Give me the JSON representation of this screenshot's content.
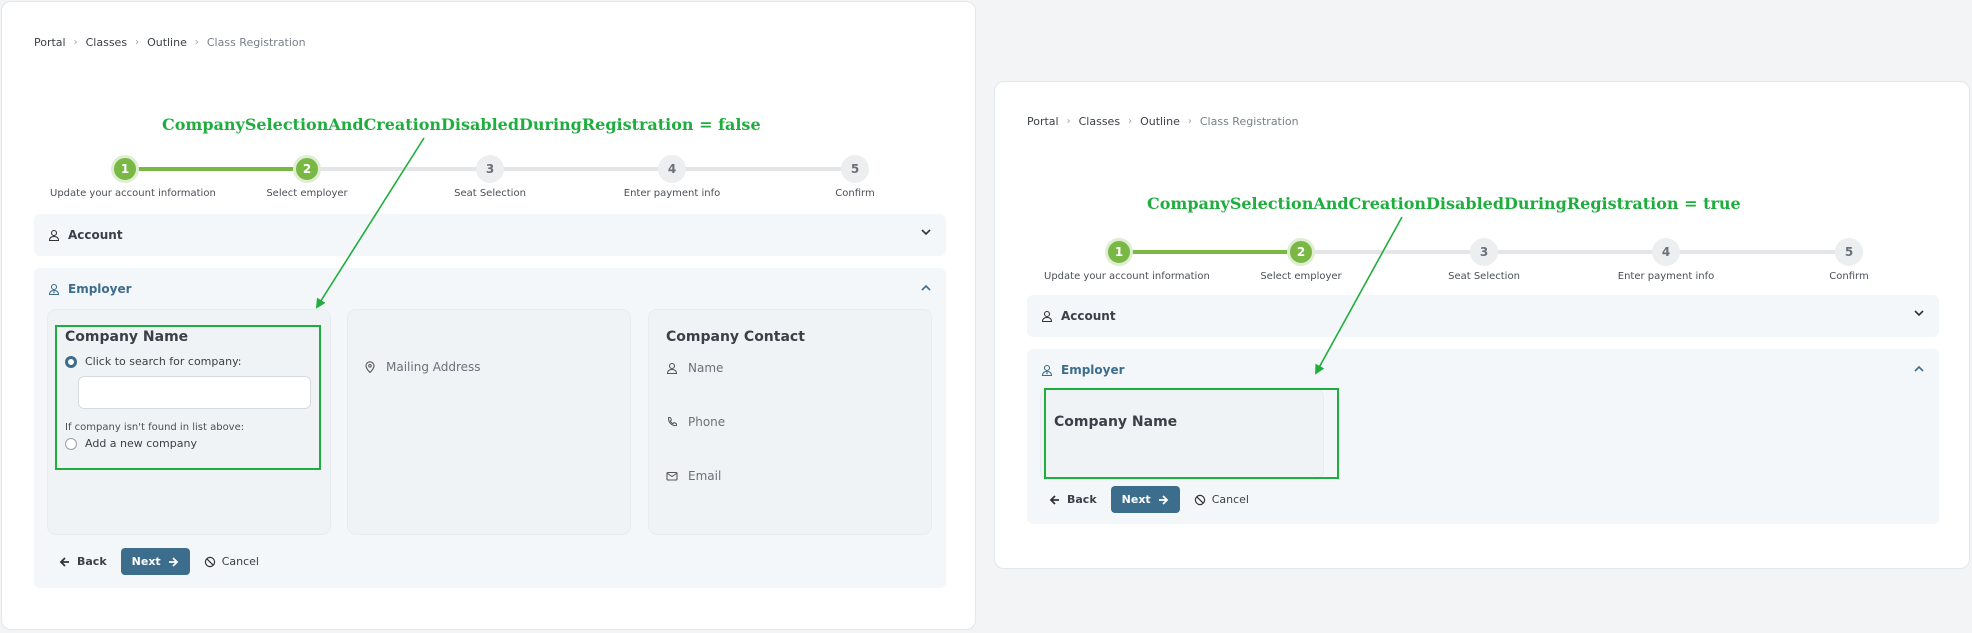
{
  "breadcrumb": [
    "Portal",
    "Classes",
    "Outline",
    "Class Registration"
  ],
  "left": {
    "annotation": "CompanySelectionAndCreationDisabledDuringRegistration = false",
    "company_card": {
      "title": "Company Name",
      "search_option": "Click to search for company:",
      "search_value": "",
      "not_found_note": "If company isn't found in list above:",
      "add_option": "Add a new company"
    },
    "address_card": {
      "mailing_address": "Mailing Address"
    },
    "contact_card": {
      "title": "Company Contact",
      "name": "Name",
      "phone": "Phone",
      "email": "Email"
    }
  },
  "right": {
    "annotation": "CompanySelectionAndCreationDisabledDuringRegistration = true",
    "company_card": {
      "title": "Company Name"
    }
  },
  "steps": [
    {
      "number": "1",
      "label": "Update your account information",
      "state": "done"
    },
    {
      "number": "2",
      "label": "Select employer",
      "state": "done"
    },
    {
      "number": "3",
      "label": "Seat Selection",
      "state": "pending"
    },
    {
      "number": "4",
      "label": "Enter payment info",
      "state": "pending"
    },
    {
      "number": "5",
      "label": "Confirm",
      "state": "pending"
    }
  ],
  "sections": {
    "account": "Account",
    "employer": "Employer"
  },
  "buttons": {
    "back": "Back",
    "next": "Next",
    "cancel": "Cancel"
  },
  "colors": {
    "accent": "#3d6d8c",
    "success": "#7ab845",
    "annotation": "#1fae3e"
  },
  "icons": {
    "account": "user-icon",
    "employer": "user-tie-icon",
    "expand": "chevron-down-icon",
    "collapse": "chevron-up-icon",
    "address": "map-pin-icon",
    "name": "user-icon",
    "phone": "phone-icon",
    "email": "envelope-icon",
    "back": "arrow-left-icon",
    "next": "arrow-right-icon",
    "cancel": "ban-icon"
  }
}
